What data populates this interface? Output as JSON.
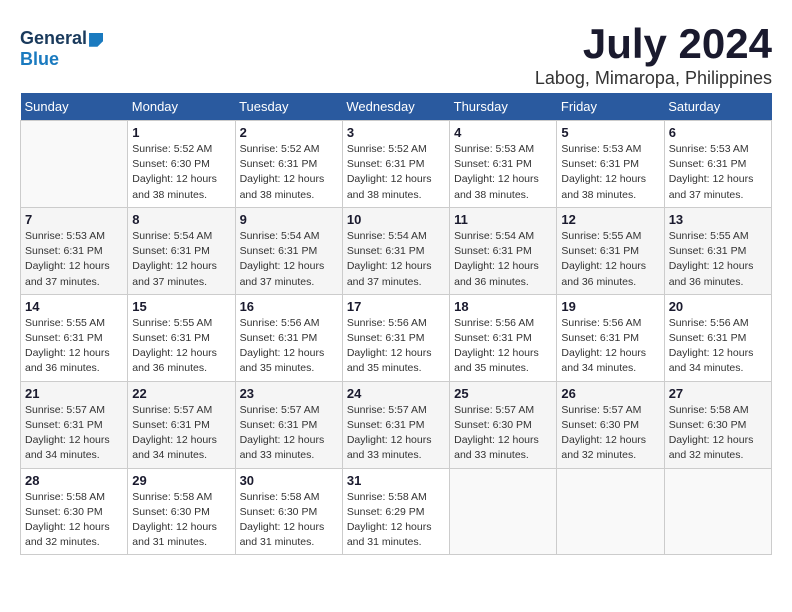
{
  "header": {
    "logo_general": "General",
    "logo_blue": "Blue",
    "title": "July 2024",
    "subtitle": "Labog, Mimaropa, Philippines"
  },
  "days_of_week": [
    "Sunday",
    "Monday",
    "Tuesday",
    "Wednesday",
    "Thursday",
    "Friday",
    "Saturday"
  ],
  "weeks": [
    [
      {
        "day": "",
        "info": ""
      },
      {
        "day": "1",
        "info": "Sunrise: 5:52 AM\nSunset: 6:30 PM\nDaylight: 12 hours\nand 38 minutes."
      },
      {
        "day": "2",
        "info": "Sunrise: 5:52 AM\nSunset: 6:31 PM\nDaylight: 12 hours\nand 38 minutes."
      },
      {
        "day": "3",
        "info": "Sunrise: 5:52 AM\nSunset: 6:31 PM\nDaylight: 12 hours\nand 38 minutes."
      },
      {
        "day": "4",
        "info": "Sunrise: 5:53 AM\nSunset: 6:31 PM\nDaylight: 12 hours\nand 38 minutes."
      },
      {
        "day": "5",
        "info": "Sunrise: 5:53 AM\nSunset: 6:31 PM\nDaylight: 12 hours\nand 38 minutes."
      },
      {
        "day": "6",
        "info": "Sunrise: 5:53 AM\nSunset: 6:31 PM\nDaylight: 12 hours\nand 37 minutes."
      }
    ],
    [
      {
        "day": "7",
        "info": "Sunrise: 5:53 AM\nSunset: 6:31 PM\nDaylight: 12 hours\nand 37 minutes."
      },
      {
        "day": "8",
        "info": "Sunrise: 5:54 AM\nSunset: 6:31 PM\nDaylight: 12 hours\nand 37 minutes."
      },
      {
        "day": "9",
        "info": "Sunrise: 5:54 AM\nSunset: 6:31 PM\nDaylight: 12 hours\nand 37 minutes."
      },
      {
        "day": "10",
        "info": "Sunrise: 5:54 AM\nSunset: 6:31 PM\nDaylight: 12 hours\nand 37 minutes."
      },
      {
        "day": "11",
        "info": "Sunrise: 5:54 AM\nSunset: 6:31 PM\nDaylight: 12 hours\nand 36 minutes."
      },
      {
        "day": "12",
        "info": "Sunrise: 5:55 AM\nSunset: 6:31 PM\nDaylight: 12 hours\nand 36 minutes."
      },
      {
        "day": "13",
        "info": "Sunrise: 5:55 AM\nSunset: 6:31 PM\nDaylight: 12 hours\nand 36 minutes."
      }
    ],
    [
      {
        "day": "14",
        "info": "Sunrise: 5:55 AM\nSunset: 6:31 PM\nDaylight: 12 hours\nand 36 minutes."
      },
      {
        "day": "15",
        "info": "Sunrise: 5:55 AM\nSunset: 6:31 PM\nDaylight: 12 hours\nand 36 minutes."
      },
      {
        "day": "16",
        "info": "Sunrise: 5:56 AM\nSunset: 6:31 PM\nDaylight: 12 hours\nand 35 minutes."
      },
      {
        "day": "17",
        "info": "Sunrise: 5:56 AM\nSunset: 6:31 PM\nDaylight: 12 hours\nand 35 minutes."
      },
      {
        "day": "18",
        "info": "Sunrise: 5:56 AM\nSunset: 6:31 PM\nDaylight: 12 hours\nand 35 minutes."
      },
      {
        "day": "19",
        "info": "Sunrise: 5:56 AM\nSunset: 6:31 PM\nDaylight: 12 hours\nand 34 minutes."
      },
      {
        "day": "20",
        "info": "Sunrise: 5:56 AM\nSunset: 6:31 PM\nDaylight: 12 hours\nand 34 minutes."
      }
    ],
    [
      {
        "day": "21",
        "info": "Sunrise: 5:57 AM\nSunset: 6:31 PM\nDaylight: 12 hours\nand 34 minutes."
      },
      {
        "day": "22",
        "info": "Sunrise: 5:57 AM\nSunset: 6:31 PM\nDaylight: 12 hours\nand 34 minutes."
      },
      {
        "day": "23",
        "info": "Sunrise: 5:57 AM\nSunset: 6:31 PM\nDaylight: 12 hours\nand 33 minutes."
      },
      {
        "day": "24",
        "info": "Sunrise: 5:57 AM\nSunset: 6:31 PM\nDaylight: 12 hours\nand 33 minutes."
      },
      {
        "day": "25",
        "info": "Sunrise: 5:57 AM\nSunset: 6:30 PM\nDaylight: 12 hours\nand 33 minutes."
      },
      {
        "day": "26",
        "info": "Sunrise: 5:57 AM\nSunset: 6:30 PM\nDaylight: 12 hours\nand 32 minutes."
      },
      {
        "day": "27",
        "info": "Sunrise: 5:58 AM\nSunset: 6:30 PM\nDaylight: 12 hours\nand 32 minutes."
      }
    ],
    [
      {
        "day": "28",
        "info": "Sunrise: 5:58 AM\nSunset: 6:30 PM\nDaylight: 12 hours\nand 32 minutes."
      },
      {
        "day": "29",
        "info": "Sunrise: 5:58 AM\nSunset: 6:30 PM\nDaylight: 12 hours\nand 31 minutes."
      },
      {
        "day": "30",
        "info": "Sunrise: 5:58 AM\nSunset: 6:30 PM\nDaylight: 12 hours\nand 31 minutes."
      },
      {
        "day": "31",
        "info": "Sunrise: 5:58 AM\nSunset: 6:29 PM\nDaylight: 12 hours\nand 31 minutes."
      },
      {
        "day": "",
        "info": ""
      },
      {
        "day": "",
        "info": ""
      },
      {
        "day": "",
        "info": ""
      }
    ]
  ]
}
